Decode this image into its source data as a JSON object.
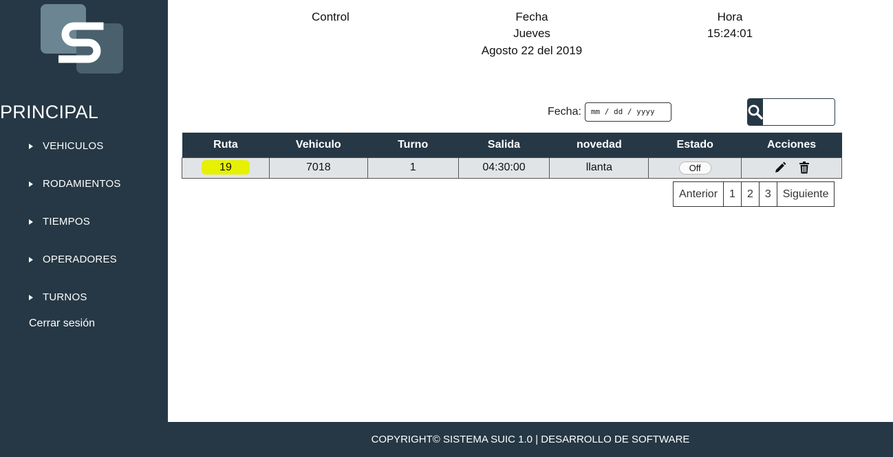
{
  "sidebar": {
    "heading": "PRINCIPAL",
    "items": [
      {
        "label": "VEHICULOS"
      },
      {
        "label": "RODAMIENTOS"
      },
      {
        "label": "TIEMPOS"
      },
      {
        "label": "OPERADORES"
      },
      {
        "label": "TURNOS"
      }
    ],
    "logout": "Cerrar sesión"
  },
  "header": {
    "control": "Control",
    "fecha_label": "Fecha",
    "day": "Jueves",
    "date": "Agosto 22 del 2019",
    "hora_label": "Hora",
    "time": "15:24:01"
  },
  "filter": {
    "fecha_label": "Fecha:",
    "date_placeholder": "mm / dd / yyyy"
  },
  "search": {
    "placeholder": ""
  },
  "table": {
    "columns": [
      "Ruta",
      "Vehiculo",
      "Turno",
      "Salida",
      "novedad",
      "Estado",
      "Acciones"
    ],
    "rows": [
      {
        "ruta": "19",
        "vehiculo": "7018",
        "turno": "1",
        "salida": "04:30:00",
        "novedad": "llanta",
        "estado": "Off"
      }
    ]
  },
  "pagination": {
    "prev": "Anterior",
    "pages": [
      "1",
      "2",
      "3"
    ],
    "next": "Siguiente"
  },
  "footer": {
    "text": "COPYRIGHT© SISTEMA SUIC 1.0 | DESARROLLO DE SOFTWARE"
  },
  "colors": {
    "sidebar": "#263845",
    "highlight": "#e6f000",
    "row_bg": "#e1e4e7"
  },
  "icons": {
    "search": "search-icon",
    "edit": "pencil-icon",
    "delete": "trash-icon",
    "menu": "triangle-right-icon"
  }
}
